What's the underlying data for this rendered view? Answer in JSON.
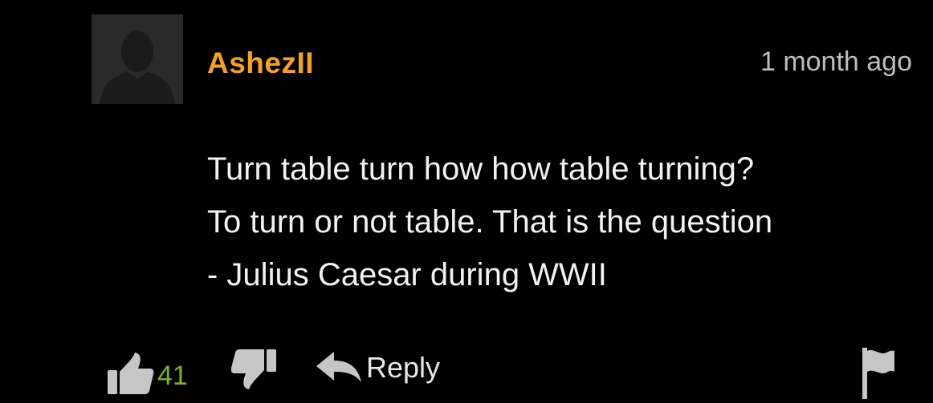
{
  "comment": {
    "author": "AshezII",
    "timestamp": "1 month ago",
    "lines": [
      "Turn table turn how how table turning?",
      "To turn or not table. That is the question",
      "- Julius Caesar during WWII"
    ]
  },
  "actions": {
    "like_count": "41",
    "reply_label": "Reply"
  },
  "icons": {
    "avatar": "default-user-silhouette-icon",
    "like": "thumbs-up-icon",
    "dislike": "thumbs-down-icon",
    "reply": "reply-arrow-icon",
    "flag": "flag-icon"
  },
  "colors": {
    "background": "#000000",
    "author": "#f7a21b",
    "like_count": "#7ab51d",
    "timestamp": "#bdbdbd",
    "icon": "#bdbdbd"
  }
}
